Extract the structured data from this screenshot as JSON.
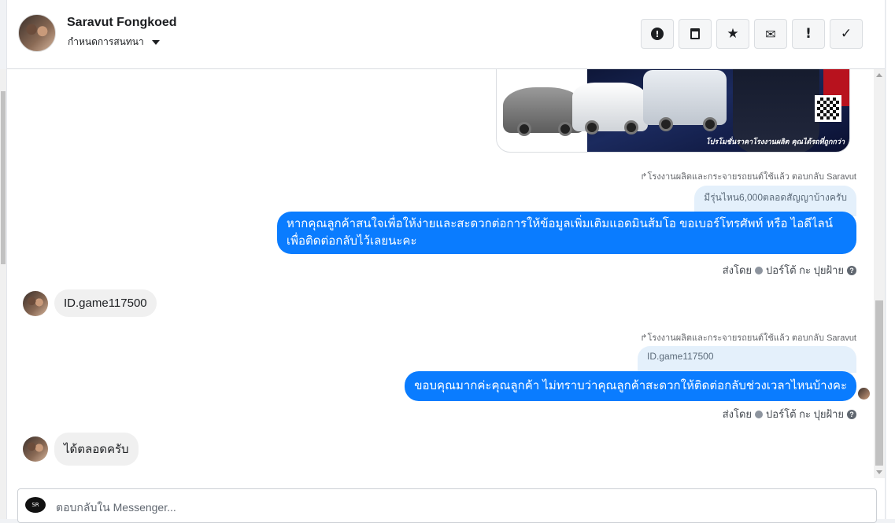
{
  "header": {
    "name": "Saravut Fongkoed",
    "subtitle": "กำหนดการสนทนา",
    "toolbar": [
      {
        "icon": "alert-circle-icon",
        "glyph": "❗"
      },
      {
        "icon": "trash-icon",
        "glyph": "🗑"
      },
      {
        "icon": "star-icon",
        "glyph": "★"
      },
      {
        "icon": "mail-blocked-icon",
        "glyph": "✉"
      },
      {
        "icon": "exclamation-icon",
        "glyph": "!"
      },
      {
        "icon": "check-icon",
        "glyph": "✓"
      }
    ]
  },
  "messages": {
    "promo_caption": "โปรโมชั่นราคาโรงงานผลิต คุณได้รถที่ถูกกว่า",
    "reply1_note": "↱โรงงานผลิตและกระจายรถยนต์ใช้แล้ว ตอบกลับ Saravut",
    "quote1": "มีรุ่นไหน6,000ตลอดสัญญาบ้างครับ",
    "out1_line1": "หากคุณลูกค้าสนใจเพื่อให้ง่ายและสะดวกต่อการให้ข้อมูลเพิ่มเติมแอดมินส้มโอ ขอเบอร์โทรศัพท์ หรือ ไอดีไลน์",
    "out1_line2": "เพื่อติดต่อกลับไว้เลยนะคะ",
    "sent_by1": "ส่งโดย",
    "sender1": "ปอร์โต้ กะ ปุยฝ้าย",
    "in1": "ID.game117500",
    "reply2_note": "↱โรงงานผลิตและกระจายรถยนต์ใช้แล้ว ตอบกลับ Saravut",
    "quote2": "ID.game117500",
    "out2": "ขอบคุณมากค่ะคุณลูกค้า ไม่ทราบว่าคุณลูกค้าสะดวกให้ติดต่อกลับช่วงเวลาไหนบ้างคะ",
    "sent_by2": "ส่งโดย",
    "sender2": "ปอร์โต้ กะ ปุยฝ้าย",
    "in2": "ได้ตลอดครับ"
  },
  "composer": {
    "placeholder": "ตอบกลับใน Messenger..."
  },
  "colors": {
    "outgoing_bubble": "#0a7cff",
    "incoming_bubble": "#f0f0f0",
    "quote_bubble": "#e4f0fb"
  }
}
